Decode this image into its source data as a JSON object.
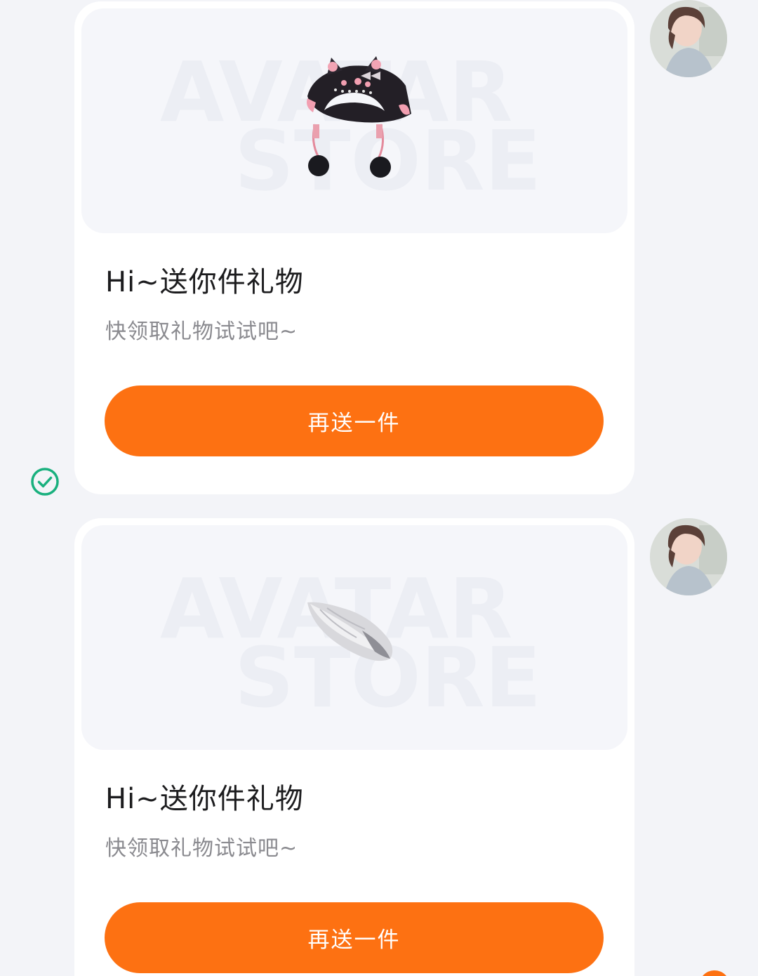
{
  "messages": [
    {
      "title": "Hi~送你件礼物",
      "subtitle": "快领取礼物试试吧~",
      "button_label": "再送一件",
      "gift_icon": "cat-ear-hat-icon",
      "watermark_line1": "AVATAR",
      "watermark_line2": "STORE",
      "status_icon": "sent-check-icon"
    },
    {
      "title": "Hi~送你件礼物",
      "subtitle": "快领取礼物试试吧~",
      "button_label": "再送一件",
      "gift_icon": "fluffy-tail-icon",
      "watermark_line1": "AVATAR",
      "watermark_line2": "STORE"
    }
  ],
  "colors": {
    "accent": "#fd7112",
    "background": "#f3f4f8",
    "card": "#ffffff",
    "check": "#19b07e"
  }
}
